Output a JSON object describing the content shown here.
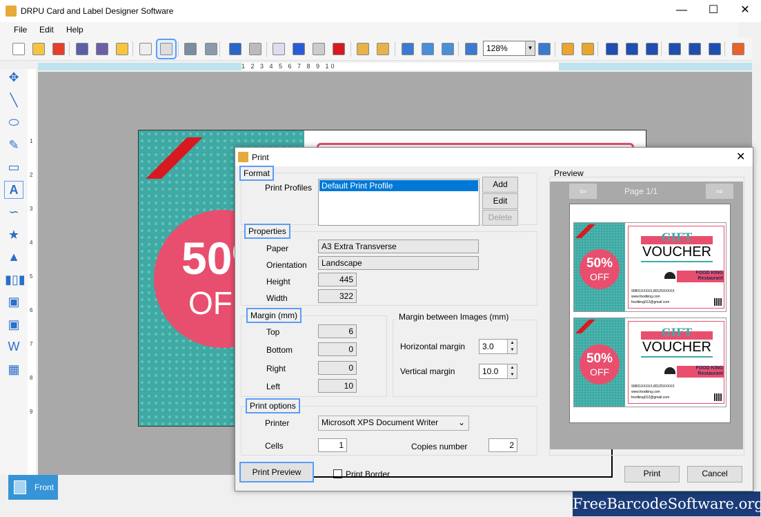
{
  "app": {
    "title": "DRPU Card and Label Designer Software",
    "window_controls": [
      "minimize",
      "maximize",
      "close"
    ]
  },
  "menu": [
    "File",
    "Edit",
    "Help"
  ],
  "toolbar": {
    "icons": [
      "new-icon",
      "open-icon",
      "close-file-icon",
      "save-icon",
      "save-as-icon",
      "export-icon",
      "edit-icon",
      "print-icon",
      "database-add-icon",
      "database-icon",
      "undo-icon",
      "redo-icon",
      "copy-icon",
      "cut-icon",
      "paste-icon",
      "delete-icon",
      "bring-front-icon",
      "send-back-icon",
      "grid-icon",
      "center-icon",
      "settings-icon",
      "zoom-in-icon",
      "zoom-out-icon",
      "lock-icon",
      "unlock-icon",
      "align-left-icon",
      "align-center-icon",
      "align-right-icon",
      "align-top-icon",
      "align-middle-icon",
      "align-bottom-icon",
      "price-icon"
    ],
    "zoom": "128%",
    "selected": "print-icon"
  },
  "ruler": {
    "h": "1 2 3 4 5 6 7 8 9 10",
    "v": [
      "1",
      "2",
      "3",
      "4",
      "5",
      "6",
      "7",
      "8",
      "9"
    ]
  },
  "toolbox": [
    "select-icon",
    "line-icon",
    "ellipse-icon",
    "pencil-icon",
    "rectangle-icon",
    "text-icon",
    "curve-icon",
    "star-icon",
    "triangle-icon",
    "barcode-icon",
    "image-icon",
    "image-library-icon",
    "wordart-icon",
    "background-icon"
  ],
  "card": {
    "discount": "50%",
    "off": "OFF"
  },
  "bottom": {
    "tab": "Front"
  },
  "watermark": "FreeBarcodeSoftware.org",
  "dialog": {
    "title": "Print",
    "format": {
      "legend": "Format",
      "profiles_label": "Print Profiles",
      "profiles": [
        "Default Print Profile"
      ],
      "add": "Add",
      "edit": "Edit",
      "delete": "Delete"
    },
    "properties": {
      "legend": "Properties",
      "paper_label": "Paper",
      "paper": "A3 Extra Transverse",
      "orientation_label": "Orientation",
      "orientation": "Landscape",
      "height_label": "Height",
      "height": "445",
      "width_label": "Width",
      "width": "322"
    },
    "margin": {
      "legend": "Margin (mm)",
      "top_label": "Top",
      "top": "6",
      "bottom_label": "Bottom",
      "bottom": "0",
      "right_label": "Right",
      "right": "0",
      "left_label": "Left",
      "left": "10"
    },
    "margin_images": {
      "legend": "Margin between Images (mm)",
      "h_label": "Horizontal margin",
      "h": "3.0",
      "v_label": "Vertical margin",
      "v": "10.0"
    },
    "print_options": {
      "legend": "Print options",
      "printer_label": "Printer",
      "printer": "Microsoft XPS Document Writer",
      "cells_label": "Cells",
      "cells": "1",
      "copies_label": "Copies number",
      "copies": "2"
    },
    "print_preview": "Print Preview",
    "print_border": "Print Border",
    "print_border_checked": false,
    "preview": {
      "legend": "Preview",
      "page": "Page 1/1"
    },
    "print": "Print",
    "cancel": "Cancel"
  },
  "voucher": {
    "discount": "50%",
    "off": "OFF",
    "gift": "GIFT",
    "voucher": "VOUCHER",
    "brand1": "FOOD KING",
    "brand2": "Restaurant",
    "phone": "90801XXXXX,80125XXXXX",
    "web": "www.foodking.com",
    "email": "foodking012@gmail.com"
  },
  "colors": {
    "accent": "#5a9cf8",
    "teal": "#3fa9a3",
    "pink": "#e84f6e",
    "watermark_bg": "#1b3c78"
  }
}
